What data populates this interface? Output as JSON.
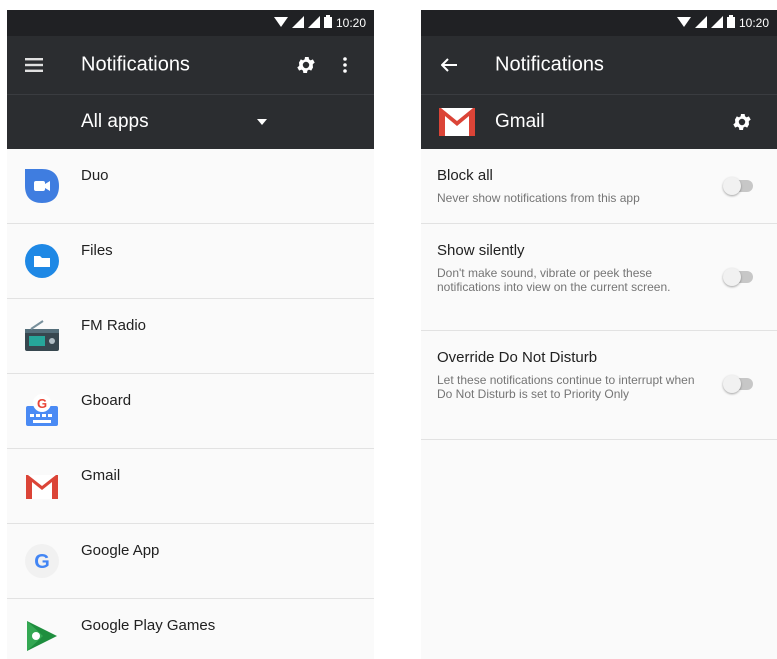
{
  "status_bar": {
    "time": "10:20"
  },
  "left_screen": {
    "toolbar": {
      "title": "Notifications"
    },
    "filter": {
      "selected": "All apps"
    },
    "apps": [
      {
        "label": "Duo",
        "icon": "duo-icon"
      },
      {
        "label": "Files",
        "icon": "files-icon"
      },
      {
        "label": "FM Radio",
        "icon": "fm-radio-icon"
      },
      {
        "label": "Gboard",
        "icon": "gboard-icon"
      },
      {
        "label": "Gmail",
        "icon": "gmail-icon"
      },
      {
        "label": "Google App",
        "icon": "google-app-icon"
      },
      {
        "label": "Google Play Games",
        "icon": "google-play-games-icon"
      }
    ]
  },
  "right_screen": {
    "toolbar": {
      "title": "Notifications"
    },
    "app_header": {
      "name": "Gmail"
    },
    "settings": [
      {
        "title": "Block all",
        "description": "Never show notifications from this app",
        "enabled": false
      },
      {
        "title": "Show silently",
        "description": "Don't make sound, vibrate or peek these notifications into view on the current screen.",
        "enabled": false
      },
      {
        "title": "Override Do Not Disturb",
        "description": "Let these notifications continue to interrupt when Do Not Disturb is set to Priority Only",
        "enabled": false
      }
    ]
  },
  "colors": {
    "appbar": "#2b2d30",
    "statusbar": "#202124",
    "list_bg": "#fafafa",
    "divider": "#e2e2e2"
  }
}
